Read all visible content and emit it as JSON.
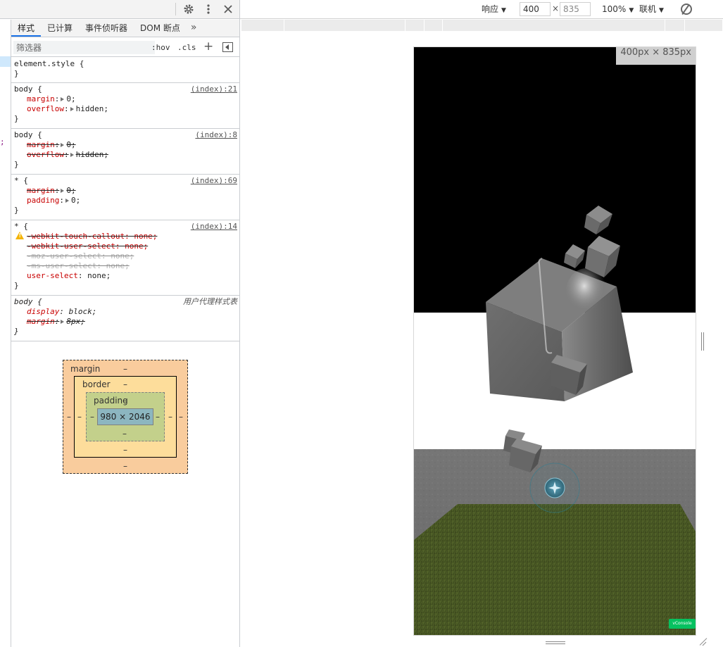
{
  "devtools": {
    "top_icons": [
      "gear-icon",
      "more-vertical-icon",
      "close-icon"
    ],
    "tabs": [
      {
        "label": "样式",
        "active": true
      },
      {
        "label": "已计算",
        "active": false
      },
      {
        "label": "事件侦听器",
        "active": false
      },
      {
        "label": "DOM 断点",
        "active": false
      }
    ],
    "tabs_more": "»",
    "filter": {
      "placeholder": "筛选器",
      "hov": ":hov",
      "cls": ".cls",
      "add": "+"
    },
    "rules": {
      "element_style": {
        "selector": "element.style {",
        "close": "}"
      },
      "r1": {
        "selector": "body {",
        "source": "(index):21",
        "p1_name": "margin",
        "p1_val": "0;",
        "p2_name": "overflow",
        "p2_val": "hidden;",
        "close": "}"
      },
      "r2": {
        "selector": "body {",
        "source": "(index):8",
        "p1_name": "margin",
        "p1_val": "0;",
        "p2_name": "overflow",
        "p2_val": "hidden;",
        "close": "}"
      },
      "r3": {
        "selector": "* {",
        "source": "(index):69",
        "p1_name": "margin",
        "p1_val": "0;",
        "p2_name": "padding",
        "p2_val": "0;",
        "close": "}"
      },
      "r4": {
        "selector": "* {",
        "source": "(index):14",
        "p1": "-webkit-touch-callout: none;",
        "p2": "-webkit-user-select: none;",
        "p3": "-moz-user-select: none;",
        "p4": "-ms-user-select: none;",
        "p5_name": "user-select",
        "p5_val": "none;",
        "close": "}"
      },
      "ua": {
        "selector": "body {",
        "source": "用户代理样式表",
        "p1_name": "display",
        "p1_val": "block;",
        "p2_name": "margin",
        "p2_val": "8px;",
        "close": "}"
      }
    },
    "box_model": {
      "margin_label": "margin",
      "border_label": "border",
      "padding_label": "padding",
      "content": "980 × 2046",
      "dash": "–"
    },
    "edge_glyph": ";"
  },
  "device_toolbar": {
    "mode": "响应",
    "width": "400",
    "times": "×",
    "height": "835",
    "zoom": "100%",
    "network": "联机",
    "rotate_icon": "rotate-icon"
  },
  "viewport": {
    "size_label": "400px × 835px",
    "vconsole": "vConsole",
    "colors": {
      "sky": "#000000",
      "wall": "#ffffff",
      "floor": "#6b6b6b",
      "grass": "#4c5b24",
      "cube": "#6d6d6d",
      "joystick": "#3b6f80"
    }
  }
}
